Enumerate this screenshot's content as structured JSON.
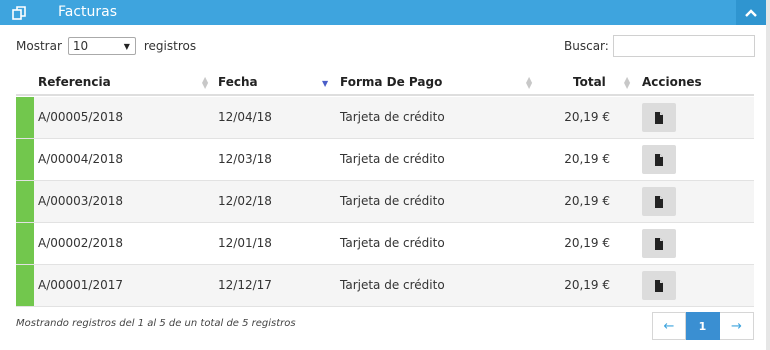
{
  "panel": {
    "title": "Facturas",
    "icon": "copy-icon",
    "collapse_icon": "chevron-up-icon"
  },
  "length": {
    "label_before": "Mostrar",
    "selected": "10",
    "label_after": "registros"
  },
  "search": {
    "label": "Buscar:",
    "value": "",
    "placeholder": ""
  },
  "table": {
    "columns": [
      "Referencia",
      "Fecha",
      "Forma De Pago",
      "Total",
      "Acciones"
    ],
    "sorted_column": "Fecha",
    "rows": [
      {
        "referencia": "A/00005/2018",
        "fecha": "12/04/18",
        "forma_pago": "Tarjeta de crédito",
        "total": "20,19 €",
        "action_icon": "document-icon"
      },
      {
        "referencia": "A/00004/2018",
        "fecha": "12/03/18",
        "forma_pago": "Tarjeta de crédito",
        "total": "20,19 €",
        "action_icon": "document-icon"
      },
      {
        "referencia": "A/00003/2018",
        "fecha": "12/02/18",
        "forma_pago": "Tarjeta de crédito",
        "total": "20,19 €",
        "action_icon": "document-icon"
      },
      {
        "referencia": "A/00002/2018",
        "fecha": "12/01/18",
        "forma_pago": "Tarjeta de crédito",
        "total": "20,19 €",
        "action_icon": "document-icon"
      },
      {
        "referencia": "A/00001/2017",
        "fecha": "12/12/17",
        "forma_pago": "Tarjeta de crédito",
        "total": "20,19 €",
        "action_icon": "document-icon"
      }
    ]
  },
  "footer": {
    "info": "Mostrando registros del 1 al 5 de un total de 5 registros",
    "prev": "←",
    "page": "1",
    "next": "→"
  },
  "colors": {
    "header": "#3ea4de",
    "status_mark": "#72c74d",
    "active_page": "#3a8fd2"
  }
}
